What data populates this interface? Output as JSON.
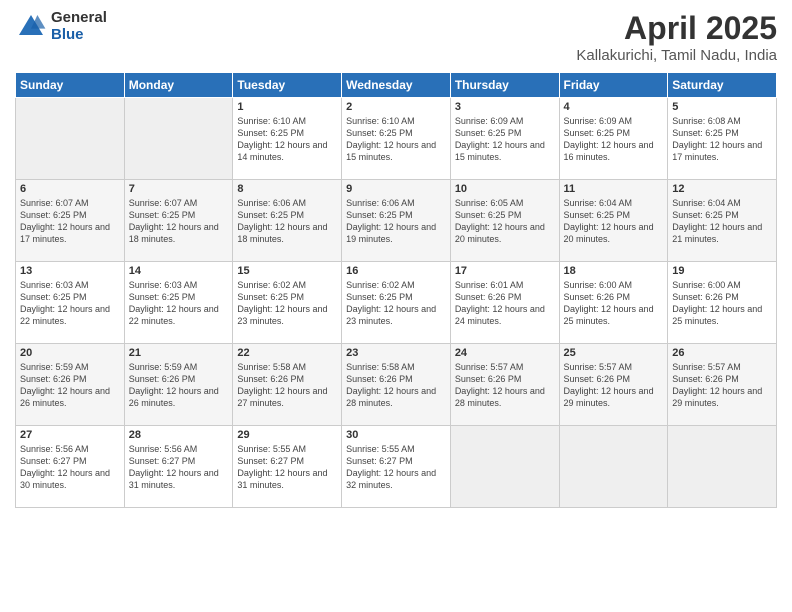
{
  "header": {
    "logo_general": "General",
    "logo_blue": "Blue",
    "title": "April 2025",
    "subtitle": "Kallakurichi, Tamil Nadu, India"
  },
  "calendar": {
    "days_of_week": [
      "Sunday",
      "Monday",
      "Tuesday",
      "Wednesday",
      "Thursday",
      "Friday",
      "Saturday"
    ],
    "weeks": [
      [
        {
          "day": "",
          "info": "",
          "empty": true
        },
        {
          "day": "",
          "info": "",
          "empty": true
        },
        {
          "day": "1",
          "info": "Sunrise: 6:10 AM\nSunset: 6:25 PM\nDaylight: 12 hours and 14 minutes."
        },
        {
          "day": "2",
          "info": "Sunrise: 6:10 AM\nSunset: 6:25 PM\nDaylight: 12 hours and 15 minutes."
        },
        {
          "day": "3",
          "info": "Sunrise: 6:09 AM\nSunset: 6:25 PM\nDaylight: 12 hours and 15 minutes."
        },
        {
          "day": "4",
          "info": "Sunrise: 6:09 AM\nSunset: 6:25 PM\nDaylight: 12 hours and 16 minutes."
        },
        {
          "day": "5",
          "info": "Sunrise: 6:08 AM\nSunset: 6:25 PM\nDaylight: 12 hours and 17 minutes."
        }
      ],
      [
        {
          "day": "6",
          "info": "Sunrise: 6:07 AM\nSunset: 6:25 PM\nDaylight: 12 hours and 17 minutes."
        },
        {
          "day": "7",
          "info": "Sunrise: 6:07 AM\nSunset: 6:25 PM\nDaylight: 12 hours and 18 minutes."
        },
        {
          "day": "8",
          "info": "Sunrise: 6:06 AM\nSunset: 6:25 PM\nDaylight: 12 hours and 18 minutes."
        },
        {
          "day": "9",
          "info": "Sunrise: 6:06 AM\nSunset: 6:25 PM\nDaylight: 12 hours and 19 minutes."
        },
        {
          "day": "10",
          "info": "Sunrise: 6:05 AM\nSunset: 6:25 PM\nDaylight: 12 hours and 20 minutes."
        },
        {
          "day": "11",
          "info": "Sunrise: 6:04 AM\nSunset: 6:25 PM\nDaylight: 12 hours and 20 minutes."
        },
        {
          "day": "12",
          "info": "Sunrise: 6:04 AM\nSunset: 6:25 PM\nDaylight: 12 hours and 21 minutes."
        }
      ],
      [
        {
          "day": "13",
          "info": "Sunrise: 6:03 AM\nSunset: 6:25 PM\nDaylight: 12 hours and 22 minutes."
        },
        {
          "day": "14",
          "info": "Sunrise: 6:03 AM\nSunset: 6:25 PM\nDaylight: 12 hours and 22 minutes."
        },
        {
          "day": "15",
          "info": "Sunrise: 6:02 AM\nSunset: 6:25 PM\nDaylight: 12 hours and 23 minutes."
        },
        {
          "day": "16",
          "info": "Sunrise: 6:02 AM\nSunset: 6:25 PM\nDaylight: 12 hours and 23 minutes."
        },
        {
          "day": "17",
          "info": "Sunrise: 6:01 AM\nSunset: 6:26 PM\nDaylight: 12 hours and 24 minutes."
        },
        {
          "day": "18",
          "info": "Sunrise: 6:00 AM\nSunset: 6:26 PM\nDaylight: 12 hours and 25 minutes."
        },
        {
          "day": "19",
          "info": "Sunrise: 6:00 AM\nSunset: 6:26 PM\nDaylight: 12 hours and 25 minutes."
        }
      ],
      [
        {
          "day": "20",
          "info": "Sunrise: 5:59 AM\nSunset: 6:26 PM\nDaylight: 12 hours and 26 minutes."
        },
        {
          "day": "21",
          "info": "Sunrise: 5:59 AM\nSunset: 6:26 PM\nDaylight: 12 hours and 26 minutes."
        },
        {
          "day": "22",
          "info": "Sunrise: 5:58 AM\nSunset: 6:26 PM\nDaylight: 12 hours and 27 minutes."
        },
        {
          "day": "23",
          "info": "Sunrise: 5:58 AM\nSunset: 6:26 PM\nDaylight: 12 hours and 28 minutes."
        },
        {
          "day": "24",
          "info": "Sunrise: 5:57 AM\nSunset: 6:26 PM\nDaylight: 12 hours and 28 minutes."
        },
        {
          "day": "25",
          "info": "Sunrise: 5:57 AM\nSunset: 6:26 PM\nDaylight: 12 hours and 29 minutes."
        },
        {
          "day": "26",
          "info": "Sunrise: 5:57 AM\nSunset: 6:26 PM\nDaylight: 12 hours and 29 minutes."
        }
      ],
      [
        {
          "day": "27",
          "info": "Sunrise: 5:56 AM\nSunset: 6:27 PM\nDaylight: 12 hours and 30 minutes."
        },
        {
          "day": "28",
          "info": "Sunrise: 5:56 AM\nSunset: 6:27 PM\nDaylight: 12 hours and 31 minutes."
        },
        {
          "day": "29",
          "info": "Sunrise: 5:55 AM\nSunset: 6:27 PM\nDaylight: 12 hours and 31 minutes."
        },
        {
          "day": "30",
          "info": "Sunrise: 5:55 AM\nSunset: 6:27 PM\nDaylight: 12 hours and 32 minutes."
        },
        {
          "day": "",
          "info": "",
          "empty": true
        },
        {
          "day": "",
          "info": "",
          "empty": true
        },
        {
          "day": "",
          "info": "",
          "empty": true
        }
      ]
    ]
  }
}
